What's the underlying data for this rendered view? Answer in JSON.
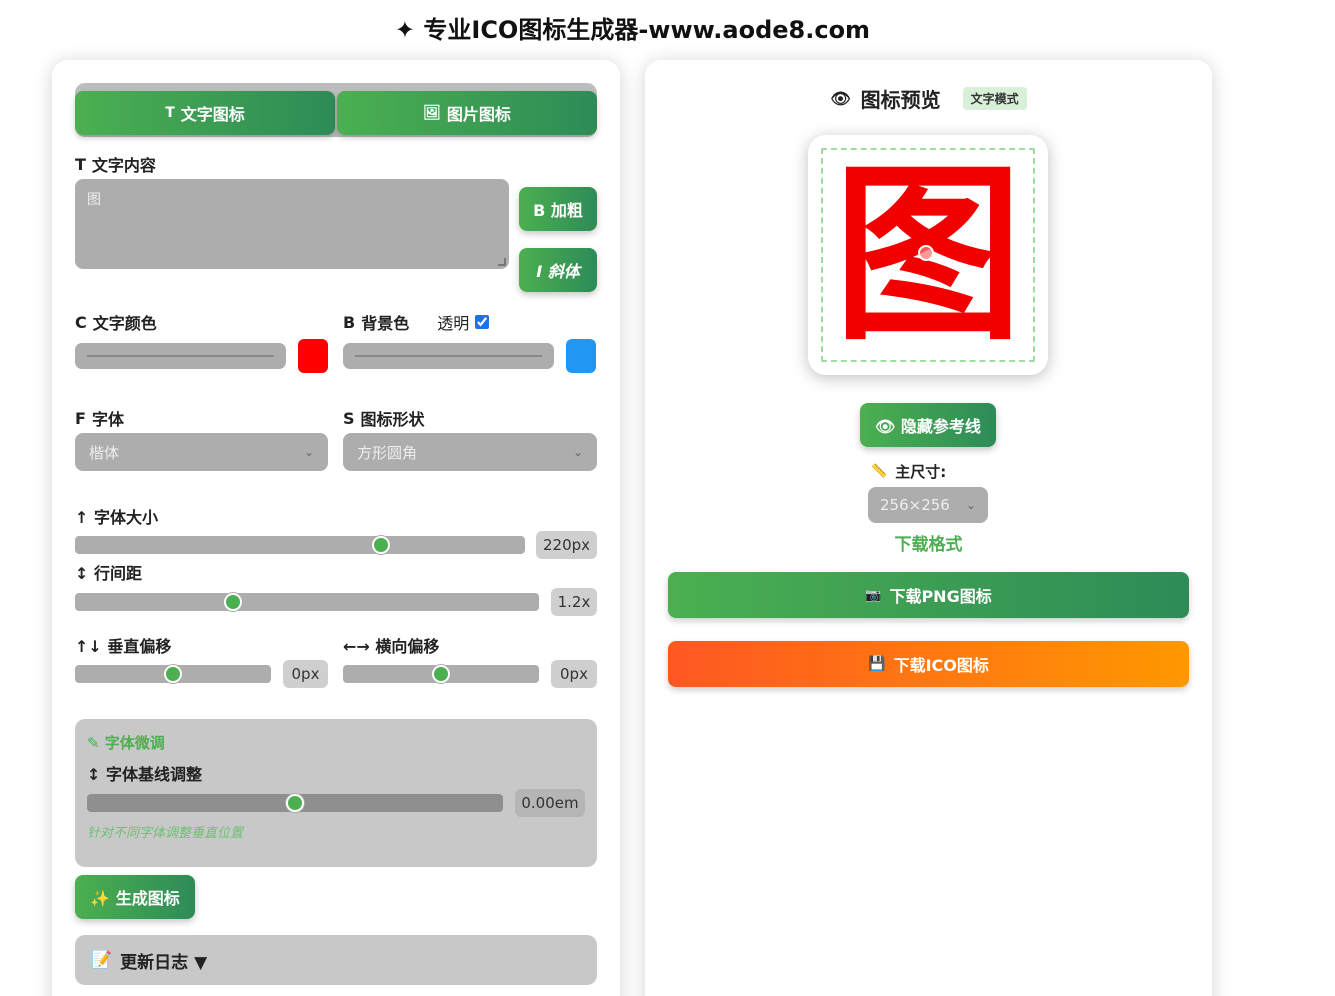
{
  "header": {
    "title": "✦ 专业ICO图标生成器-www.aode8.com"
  },
  "tabs": [
    {
      "icon": "T",
      "label": "文字图标"
    },
    {
      "icon": "🖼",
      "label": "图片图标"
    }
  ],
  "text_content": {
    "label_prefix": "T",
    "label": "文字内容",
    "value": "图",
    "bold_button": "B 加粗",
    "italic_button": "I 斜体"
  },
  "colors": {
    "text_color_prefix": "C",
    "text_color_label": "文字颜色",
    "text_color_value": "#ff0000",
    "bg_prefix": "B",
    "bg_label": "背景色",
    "transparent_label": "透明",
    "transparent_checked": true,
    "bg_color_value": "#2196f3"
  },
  "font": {
    "prefix": "F",
    "label": "字体",
    "selected": "楷体"
  },
  "shape": {
    "prefix": "S",
    "label": "图标形状",
    "selected": "方形圆角"
  },
  "sliders": {
    "font_size": {
      "label": "↑ 字体大小",
      "value": "220px",
      "fraction": 0.68
    },
    "line_height": {
      "label": "↕ 行间距",
      "value": "1.2x",
      "fraction": 0.34
    },
    "v_offset": {
      "label": "↑↓ 垂直偏移",
      "value": "0px",
      "fraction": 0.5
    },
    "h_offset": {
      "label": "←→ 横向偏移",
      "value": "0px",
      "fraction": 0.5
    }
  },
  "fine_tune": {
    "title": "✎ 字体微调",
    "baseline_label": "↕ 字体基线调整",
    "baseline_value": "0.00em",
    "baseline_fraction": 0.5,
    "note": "针对不同字体调整垂直位置"
  },
  "generate_button": "✨ 生成图标",
  "changelog": {
    "icon": "📝",
    "label": "更新日志 ▼"
  },
  "preview": {
    "eye_icon": "👁",
    "title": "图标预览",
    "mode_badge": "文字模式",
    "glyph": "图",
    "glyph_color": "#f20000",
    "toggle_guides": "👁 隐藏参考线",
    "size_label_icon": "📏",
    "size_label": "主尺寸:",
    "size_selected": "256×256",
    "download_format": "下载格式",
    "png_button": "下载PNG图标",
    "png_icon": "📷",
    "ico_button": "下载ICO图标",
    "ico_icon": "💾"
  }
}
